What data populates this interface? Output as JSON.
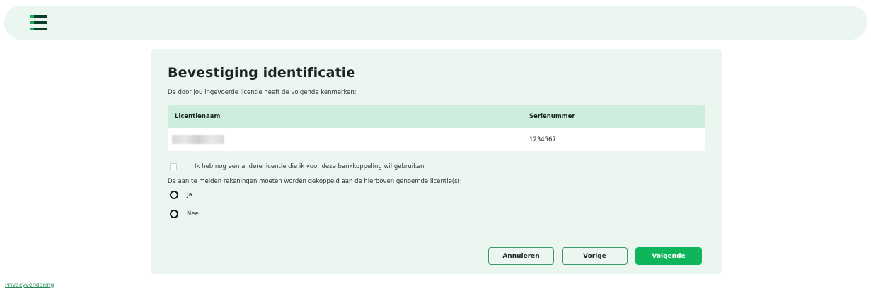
{
  "header": {
    "logo": "app-logo-icon"
  },
  "page": {
    "title": "Bevestiging identificatie",
    "subtitle": "De door jou ingevoerde licentie heeft de volgende kenmerken:"
  },
  "table": {
    "headers": [
      "Licentienaam",
      "Serienummer"
    ],
    "rows": [
      {
        "licentienaam": "",
        "serienummer": "1234567"
      }
    ]
  },
  "checkbox": {
    "label": "Ik heb nog een andere licentie die ik voor deze bankkoppeling wil gebruiken",
    "checked": false
  },
  "question": "De aan te melden rekeningen moeten worden gekoppeld aan de hierboven genoemde licentie(s):",
  "radio_options": [
    {
      "label": "Ja",
      "selected": false
    },
    {
      "label": "Nee",
      "selected": false
    }
  ],
  "buttons": {
    "cancel": "Annuleren",
    "previous": "Vorige",
    "next": "Volgende"
  },
  "footer": {
    "privacy_link": "Privacyverklaring"
  },
  "colors": {
    "brand_green": "#0fb55a",
    "panel_bg": "#eaf6ef",
    "table_header_bg": "#cdeedd",
    "link": "#2a8a5a"
  }
}
